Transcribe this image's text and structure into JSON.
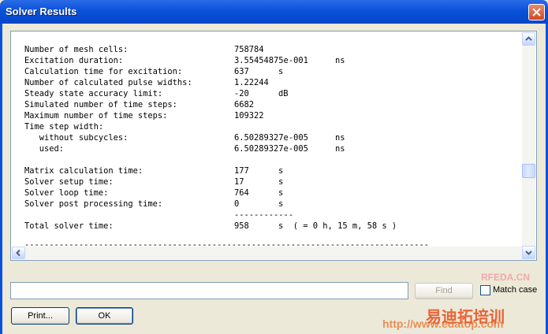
{
  "window": {
    "title": "Solver Results"
  },
  "results": {
    "rows": [
      {
        "label": "Number of mesh cells:",
        "value": "758784",
        "unit": ""
      },
      {
        "label": "Excitation duration:",
        "value": "3.55454875e-001",
        "unit": "ns"
      },
      {
        "label": "Calculation time for excitation:",
        "value": "637",
        "unit": "s"
      },
      {
        "label": "Number of calculated pulse widths:",
        "value": "1.22244",
        "unit": ""
      },
      {
        "label": "Steady state accuracy limit:",
        "value": "-20",
        "unit": "dB"
      },
      {
        "label": "Simulated number of time steps:",
        "value": "6682",
        "unit": ""
      },
      {
        "label": "Maximum number of time steps:",
        "value": "109322",
        "unit": ""
      },
      {
        "label": "Time step width:",
        "value": "",
        "unit": ""
      },
      {
        "label": "   without subcycles:",
        "value": "6.50289327e-005",
        "unit": "ns"
      },
      {
        "label": "   used:",
        "value": "6.50289327e-005",
        "unit": "ns"
      },
      {
        "label": "",
        "value": "",
        "unit": ""
      },
      {
        "label": "Matrix calculation time:",
        "value": "177",
        "unit": "s"
      },
      {
        "label": "Solver setup time:",
        "value": "17",
        "unit": "s"
      },
      {
        "label": "Solver loop time:",
        "value": "764",
        "unit": "s"
      },
      {
        "label": "Solver post processing time:",
        "value": "0",
        "unit": "s"
      },
      {
        "label": "",
        "value": "------------",
        "unit": ""
      },
      {
        "label": "Total solver time:",
        "value": "958",
        "unit": "s  ( = 0 h, 15 m, 58 s )"
      }
    ],
    "separator": "----------------------------------------------------------------------------------"
  },
  "find": {
    "value": "",
    "button": "Find",
    "match_case_label": "Match case",
    "match_case_checked": false
  },
  "buttons": {
    "print": "Print...",
    "ok": "OK"
  },
  "watermark": {
    "site": "RFEDA.CN",
    "brand": "易迪拓培训",
    "url": "http://www.edatop.com"
  },
  "colors": {
    "titlebar": "#0a52da",
    "background": "#ece9d8",
    "watermark": "#e84d1c"
  },
  "icons": {
    "close": "close-icon",
    "scroll_up": "chevron-up-icon",
    "scroll_down": "chevron-down-icon",
    "scroll_left": "chevron-left-icon"
  }
}
